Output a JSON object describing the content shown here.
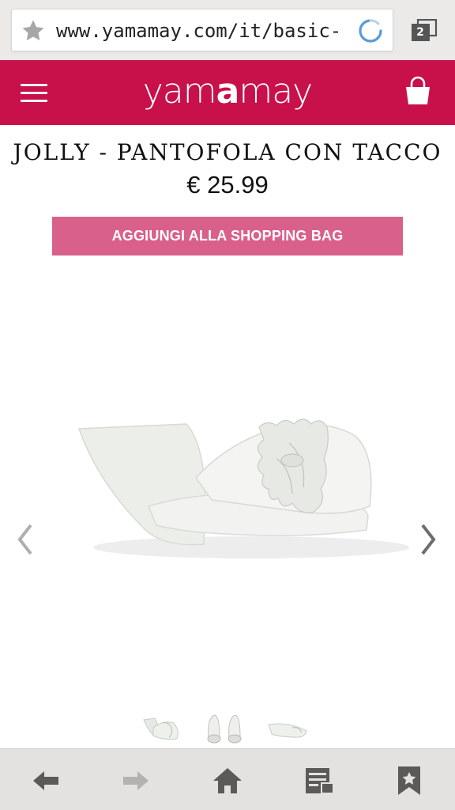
{
  "browser": {
    "url": "www.yamamay.com/it/basic-",
    "tab_count": "2"
  },
  "header": {
    "logo_part1": "yam",
    "logo_part2": "a",
    "logo_part3": "may"
  },
  "product": {
    "title": "JOLLY - PANTOFOLA CON TACCO",
    "price": "€ 25.99",
    "add_button_label": "AGGIUNGI ALLA SHOPPING BAG"
  },
  "colors": {
    "brand": "#c8104a",
    "button": "#d9608a",
    "toolbar": "#e4e2e0"
  },
  "icons": [
    "star-icon",
    "reload-icon",
    "tabs-icon",
    "menu-icon",
    "shopping-bag-icon",
    "chevron-left-icon",
    "chevron-right-icon",
    "back-arrow-icon",
    "forward-arrow-icon",
    "home-icon",
    "reader-icon",
    "bookmark-icon"
  ]
}
